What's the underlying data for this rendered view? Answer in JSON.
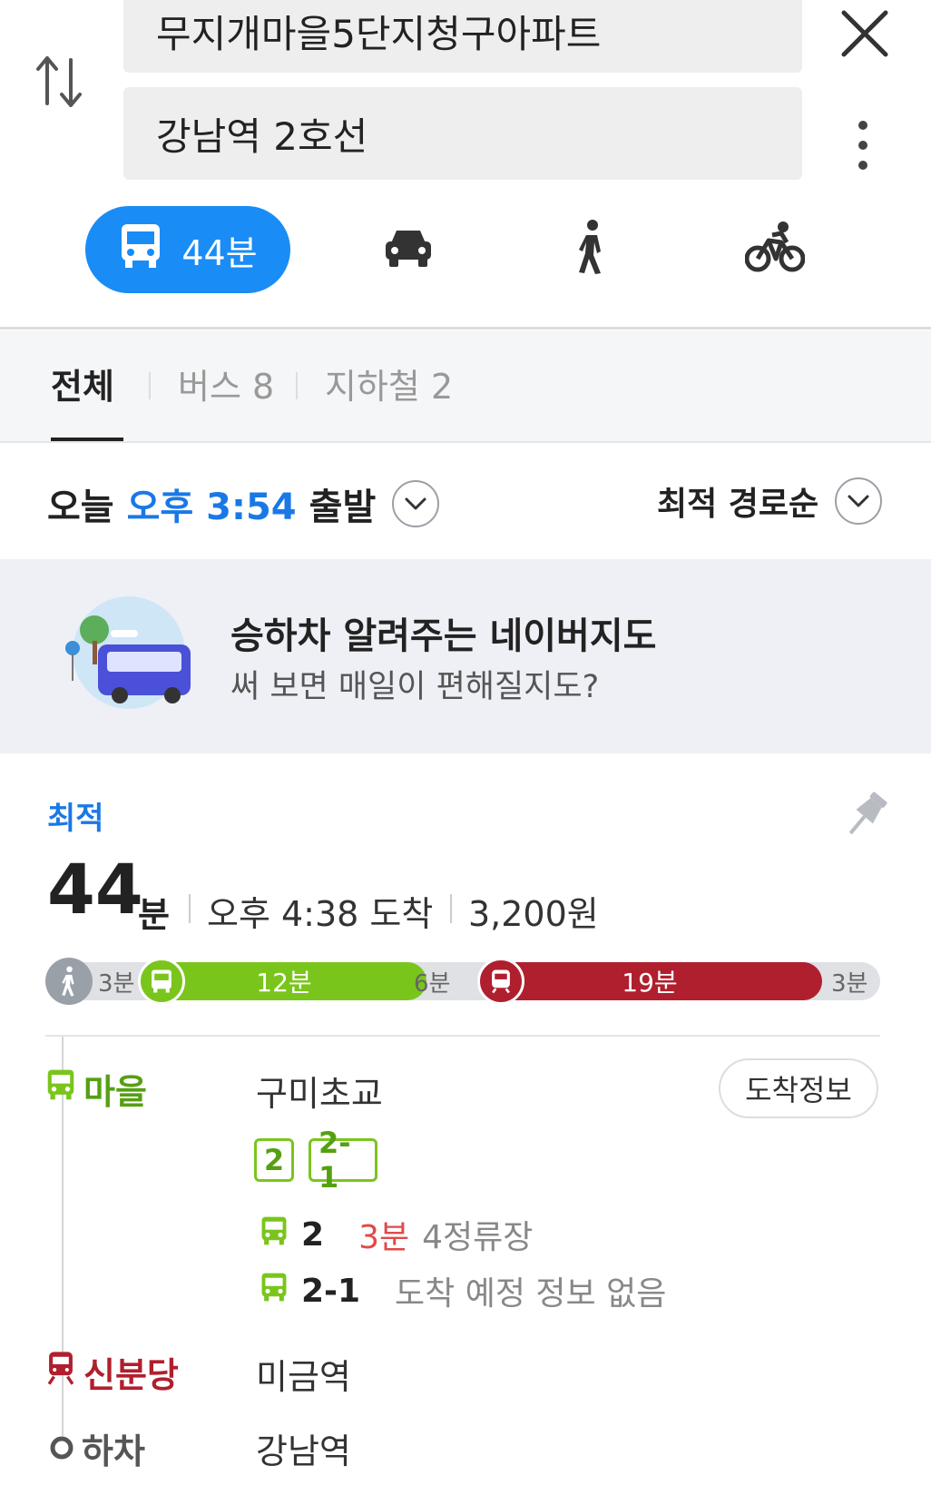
{
  "search": {
    "origin": "무지개마을5단지청구아파트",
    "destination": "강남역 2호선"
  },
  "modes": {
    "transit_time": "44분"
  },
  "tabs": [
    {
      "label": "전체"
    },
    {
      "label": "버스 8"
    },
    {
      "label": "지하철 2"
    }
  ],
  "depart": {
    "day": "오늘",
    "time": "오후 3:54",
    "suffix": "출발"
  },
  "sort": {
    "label": "최적 경로순"
  },
  "banner": {
    "title": "승하차 알려주는 네이버지도",
    "subtitle": "써 보면 매일이 편해질지도?"
  },
  "route": {
    "tag": "최적",
    "duration_value": "44",
    "duration_unit": "분",
    "arrival": "오후 4:38 도착",
    "fare": "3,200원",
    "segments": {
      "walk1": "3분",
      "bus": "12분",
      "gap": "6분",
      "subway": "19분",
      "walk2": "3분"
    },
    "stops": [
      {
        "type": "마을",
        "name": "구미초교"
      },
      {
        "type": "신분당",
        "name": "미금역"
      },
      {
        "type": "하차",
        "name": "강남역"
      }
    ],
    "arrival_info_button": "도착정보",
    "bus_numbers": [
      "2",
      "2-1"
    ],
    "arrivals": [
      {
        "no": "2",
        "time": "3분",
        "detail": "4정류장"
      },
      {
        "no": "2-1",
        "detail": "도착 예정 정보 없음"
      }
    ]
  },
  "colors": {
    "accent_blue": "#1a8cf6",
    "bus_green": "#7ac51c",
    "subway_red": "#b01f2e"
  },
  "icons": [
    "swap-icon",
    "close-icon",
    "more-vertical-icon",
    "bus-icon",
    "car-icon",
    "walk-icon",
    "bicycle-icon",
    "chevron-down-icon",
    "pin-icon",
    "subway-icon"
  ]
}
